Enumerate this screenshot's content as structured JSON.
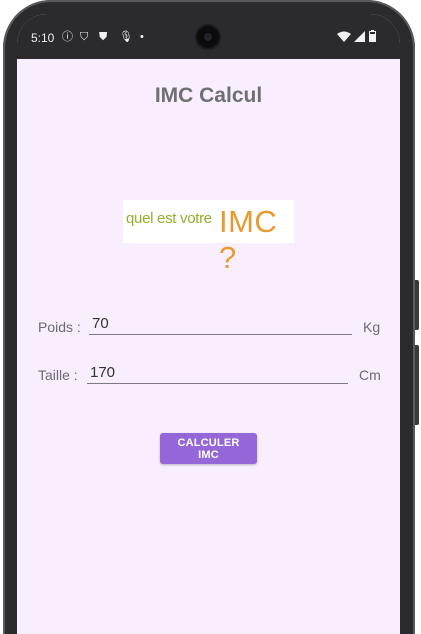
{
  "status_bar": {
    "time": "5:10",
    "left_icons": [
      "info-icon",
      "shield-icon",
      "vpn-shield-icon",
      "mic-icon",
      "dot-icon"
    ],
    "right_icons": [
      "wifi-icon",
      "signal-icon",
      "battery-icon"
    ]
  },
  "app": {
    "title": "IMC Calcul",
    "logo": {
      "text_small": "quel est votre",
      "text_big": "IMC ?",
      "color_small": "#8fb02c",
      "color_big": "#e79a2d"
    }
  },
  "form": {
    "weight": {
      "label": "Poids :",
      "value": "70",
      "unit": "Kg"
    },
    "height": {
      "label": "Taille :",
      "value": "170",
      "unit": "Cm"
    },
    "submit_label": "CALCULER IMC"
  },
  "colors": {
    "background": "#f8eefd",
    "accent": "#9466d8",
    "title": "#6f6f74"
  }
}
